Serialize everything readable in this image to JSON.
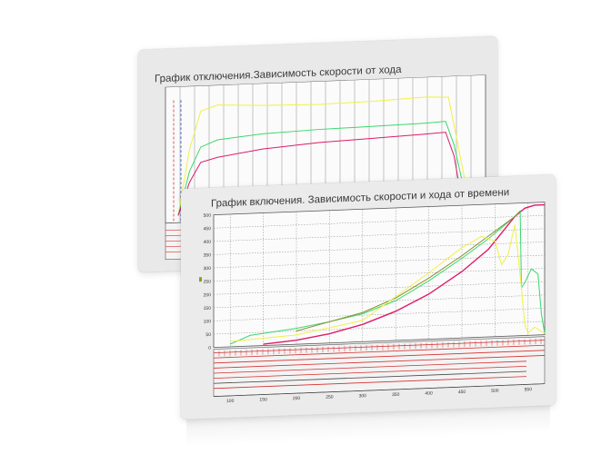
{
  "colors": {
    "green": "#39d86b",
    "magenta": "#e0196a",
    "yellow": "#f2f046",
    "olive": "#8a8a2a",
    "red": "#d43030",
    "grid": "#8c8c8c"
  },
  "chart_data": [
    {
      "type": "line",
      "title": "График отключения.Зависимость скорости от хода",
      "grid": true,
      "series": [
        {
          "color": "yellow",
          "values": [
            [
              0,
              0
            ],
            [
              4,
              60
            ],
            [
              8,
              95
            ],
            [
              14,
              100
            ],
            [
              30,
              98
            ],
            [
              50,
              97
            ],
            [
              70,
              98
            ],
            [
              88,
              100
            ],
            [
              96,
              99
            ],
            [
              99,
              60
            ],
            [
              102,
              20
            ],
            [
              104,
              0
            ]
          ]
        },
        {
          "color": "green",
          "values": [
            [
              0,
              0
            ],
            [
              4,
              40
            ],
            [
              8,
              62
            ],
            [
              14,
              68
            ],
            [
              30,
              72
            ],
            [
              50,
              74
            ],
            [
              70,
              75
            ],
            [
              88,
              76
            ],
            [
              95,
              77
            ],
            [
              98,
              55
            ],
            [
              101,
              20
            ],
            [
              103,
              0
            ]
          ]
        },
        {
          "color": "magenta",
          "values": [
            [
              0,
              0
            ],
            [
              4,
              30
            ],
            [
              8,
              48
            ],
            [
              14,
              52
            ],
            [
              30,
              58
            ],
            [
              50,
              62
            ],
            [
              70,
              64
            ],
            [
              88,
              66
            ],
            [
              95,
              67
            ],
            [
              98,
              45
            ],
            [
              100,
              15
            ],
            [
              102,
              0
            ]
          ]
        }
      ]
    },
    {
      "type": "line",
      "title": "График включения. Зависимость скорости и хода от времени",
      "x_ticks": [
        "100",
        "150",
        "200",
        "250",
        "300",
        "350",
        "400",
        "450",
        "500",
        "550"
      ],
      "y_ticks": [
        "500",
        "450",
        "400",
        "350",
        "300",
        "250",
        "200",
        "150",
        "100",
        "50",
        "0"
      ],
      "xlim": [
        75,
        575
      ],
      "ylim": [
        0,
        500
      ],
      "grid": true,
      "series": [
        {
          "color": "magenta",
          "values": [
            [
              150,
              5
            ],
            [
              200,
              15
            ],
            [
              250,
              35
            ],
            [
              300,
              65
            ],
            [
              350,
              110
            ],
            [
              400,
              170
            ],
            [
              450,
              250
            ],
            [
              490,
              330
            ],
            [
              510,
              390
            ],
            [
              530,
              450
            ],
            [
              545,
              480
            ],
            [
              560,
              490
            ],
            [
              575,
              490
            ]
          ]
        },
        {
          "color": "green",
          "values": [
            [
              100,
              10
            ],
            [
              130,
              40
            ],
            [
              200,
              60
            ],
            [
              250,
              80
            ],
            [
              300,
              105
            ],
            [
              350,
              150
            ],
            [
              400,
              220
            ],
            [
              450,
              300
            ],
            [
              490,
              370
            ],
            [
              520,
              430
            ],
            [
              532,
              455
            ],
            [
              538,
              470
            ],
            [
              540,
              180
            ],
            [
              545,
              200
            ],
            [
              555,
              250
            ],
            [
              565,
              230
            ],
            [
              570,
              80
            ],
            [
              575,
              5
            ]
          ]
        },
        {
          "color": "olive",
          "values": [
            [
              200,
              50
            ],
            [
              250,
              80
            ],
            [
              300,
              110
            ],
            [
              350,
              160
            ],
            [
              400,
              230
            ],
            [
              450,
              310
            ],
            [
              490,
              380
            ],
            [
              530,
              450
            ],
            [
              538,
              470
            ]
          ]
        },
        {
          "color": "yellow",
          "values": [
            [
              100,
              20
            ],
            [
              200,
              35
            ],
            [
              300,
              80
            ],
            [
              400,
              250
            ],
            [
              450,
              340
            ],
            [
              480,
              380
            ],
            [
              500,
              360
            ],
            [
              510,
              270
            ],
            [
              520,
              310
            ],
            [
              530,
              420
            ],
            [
              540,
              180
            ],
            [
              545,
              40
            ],
            [
              550,
              10
            ],
            [
              560,
              30
            ],
            [
              575,
              5
            ]
          ]
        }
      ]
    }
  ]
}
